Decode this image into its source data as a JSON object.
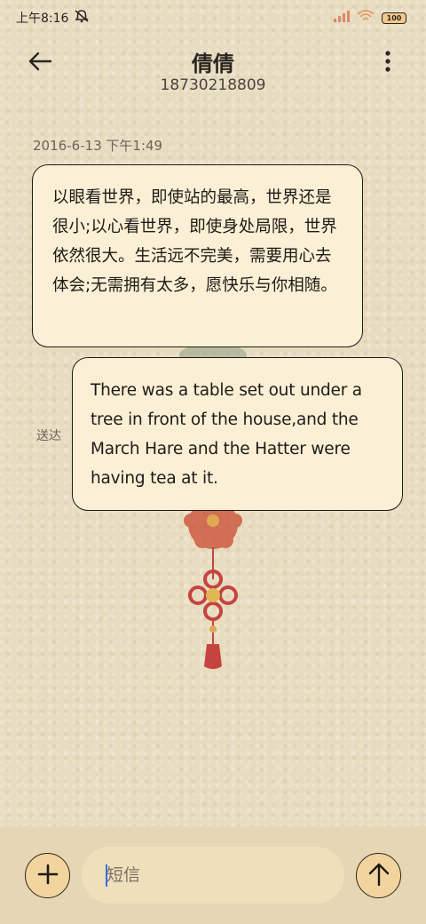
{
  "status_bar": {
    "time": "上午8:16",
    "mute_icon": "bell-off-icon",
    "signal_icon": "signal-icon",
    "wifi_icon": "wifi-icon",
    "battery": "100"
  },
  "header": {
    "back_icon": "arrow-left-icon",
    "contact_name": "倩倩",
    "phone_number": "18730218809",
    "more_icon": "more-vertical-icon"
  },
  "conversation": {
    "timestamp": "2016-6-13 下午1:49",
    "messages": [
      {
        "direction": "incoming",
        "text": "以眼看世界，即使站的最高，世界还是很小;以心看世界，即使身处局限，世界依然很大。生活远不完美，需要用心去体会;无需拥有太多，愿快乐与你相随。"
      },
      {
        "direction": "outgoing",
        "text": "There was a table set out under a tree in front of the house,and the March Hare and the Hatter were having tea at it.",
        "status": "送达"
      }
    ],
    "background_decoration": "chinese-knot"
  },
  "composer": {
    "add_icon": "plus-icon",
    "placeholder": "短信",
    "value": "",
    "send_icon": "arrow-up-icon"
  },
  "colors": {
    "background": "#e8dcc0",
    "bubble": "#fbf0d6",
    "button_fill": "#f2d59e",
    "caret": "#3a6ee8"
  }
}
